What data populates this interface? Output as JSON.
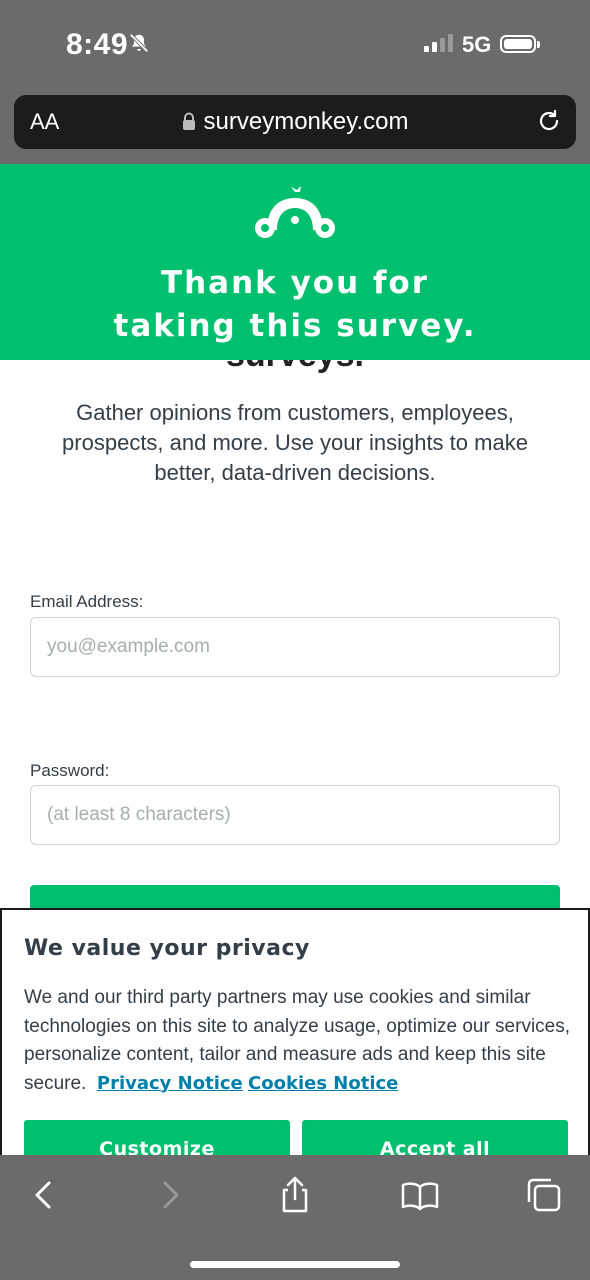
{
  "status_bar": {
    "time": "8:49",
    "network": "5G",
    "icons": [
      "bell-slash-icon",
      "signal-icon",
      "battery-icon"
    ]
  },
  "browser": {
    "text_size_label": "AA",
    "url": "surveymonkey.com",
    "icons": [
      "lock-icon",
      "reload-icon"
    ]
  },
  "header": {
    "logo": "surveymonkey-logo",
    "title": "Thank you for taking this survey.",
    "bg_color": "#00bf6f"
  },
  "main": {
    "cut_heading": "surveys.",
    "intro": "Gather opinions from customers, employees, prospects, and more. Use your insights to make better, data-driven decisions.",
    "email": {
      "label": "Email Address:",
      "placeholder": "you@example.com",
      "value": ""
    },
    "password": {
      "label": "Password:",
      "placeholder": "(at least 8 characters)",
      "value": ""
    }
  },
  "cookie_banner": {
    "title": "We value your privacy",
    "body": "We and our third party partners may use cookies and similar technologies on this site to analyze usage, optimize our services, personalize content, tailor and measure ads and keep this site secure.",
    "privacy_link": "Privacy Notice",
    "cookies_link": "Cookies Notice",
    "customize_label": "Customize",
    "accept_label": "Accept all"
  },
  "toolbar": {
    "icons": [
      "back-icon",
      "forward-icon",
      "share-icon",
      "bookmarks-icon",
      "tabs-icon"
    ]
  }
}
